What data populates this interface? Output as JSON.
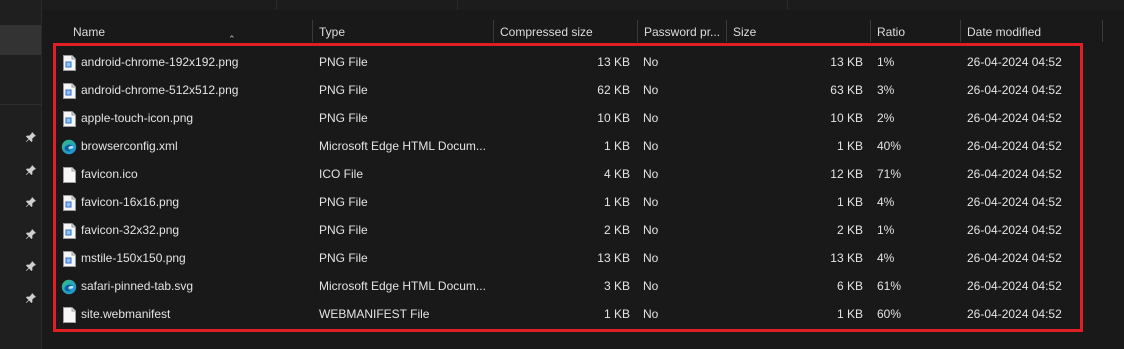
{
  "colors": {
    "background": "#191919",
    "highlight_border": "#e01f25",
    "edge_icon_blue": "#1e88e5",
    "edge_icon_green": "#33c481"
  },
  "columns": {
    "name": "Name",
    "type": "Type",
    "compressed_size": "Compressed size",
    "password": "Password pr...",
    "size": "Size",
    "ratio": "Ratio",
    "date_modified": "Date modified"
  },
  "files": [
    {
      "name": "android-chrome-192x192.png",
      "type": "PNG File",
      "compressed": "13 KB",
      "password": "No",
      "size": "13 KB",
      "ratio": "1%",
      "date": "26-04-2024 04:52",
      "icon": "png-file-icon"
    },
    {
      "name": "android-chrome-512x512.png",
      "type": "PNG File",
      "compressed": "62 KB",
      "password": "No",
      "size": "63 KB",
      "ratio": "3%",
      "date": "26-04-2024 04:52",
      "icon": "png-file-icon"
    },
    {
      "name": "apple-touch-icon.png",
      "type": "PNG File",
      "compressed": "10 KB",
      "password": "No",
      "size": "10 KB",
      "ratio": "2%",
      "date": "26-04-2024 04:52",
      "icon": "png-file-icon"
    },
    {
      "name": "browserconfig.xml",
      "type": "Microsoft Edge HTML Docum...",
      "compressed": "1 KB",
      "password": "No",
      "size": "1 KB",
      "ratio": "40%",
      "date": "26-04-2024 04:52",
      "icon": "edge-icon"
    },
    {
      "name": "favicon.ico",
      "type": "ICO File",
      "compressed": "4 KB",
      "password": "No",
      "size": "12 KB",
      "ratio": "71%",
      "date": "26-04-2024 04:52",
      "icon": "blank-file-icon"
    },
    {
      "name": "favicon-16x16.png",
      "type": "PNG File",
      "compressed": "1 KB",
      "password": "No",
      "size": "1 KB",
      "ratio": "4%",
      "date": "26-04-2024 04:52",
      "icon": "png-file-icon"
    },
    {
      "name": "favicon-32x32.png",
      "type": "PNG File",
      "compressed": "2 KB",
      "password": "No",
      "size": "2 KB",
      "ratio": "1%",
      "date": "26-04-2024 04:52",
      "icon": "png-file-icon"
    },
    {
      "name": "mstile-150x150.png",
      "type": "PNG File",
      "compressed": "13 KB",
      "password": "No",
      "size": "13 KB",
      "ratio": "4%",
      "date": "26-04-2024 04:52",
      "icon": "png-file-icon"
    },
    {
      "name": "safari-pinned-tab.svg",
      "type": "Microsoft Edge HTML Docum...",
      "compressed": "3 KB",
      "password": "No",
      "size": "6 KB",
      "ratio": "61%",
      "date": "26-04-2024 04:52",
      "icon": "edge-icon"
    },
    {
      "name": "site.webmanifest",
      "type": "WEBMANIFEST File",
      "compressed": "1 KB",
      "password": "No",
      "size": "1 KB",
      "ratio": "60%",
      "date": "26-04-2024 04:52",
      "icon": "blank-file-icon"
    }
  ]
}
